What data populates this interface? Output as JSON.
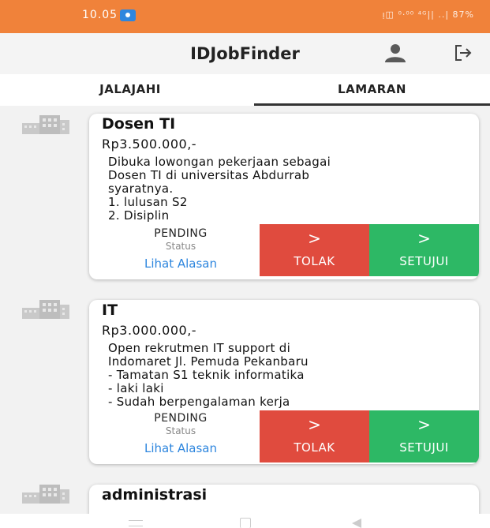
{
  "status_bar": {
    "time": "10.05",
    "right_indicators": "ᴉ◫ ⁰·⁰⁰ ⁴ᴳ|| ..| 87%",
    "battery_percent": 87
  },
  "app_bar": {
    "title": "IDJobFinder",
    "profile_icon": "person-icon",
    "logout_icon": "logout-icon"
  },
  "tabs": [
    {
      "label": "JALAJAHI",
      "active": false
    },
    {
      "label": "LAMARAN",
      "active": true
    }
  ],
  "jobs": [
    {
      "title": "Dosen TI",
      "salary": "Rp3.500.000,-",
      "description": "Dibuka lowongan pekerjaan sebagai\nDosen TI di universitas Abdurrab\nsyaratnya.\n1. lulusan S2\n2. Disiplin",
      "status_value": "PENDING",
      "status_label": "Status",
      "reason_link": "Lihat Alasan",
      "reject_arrow": ">",
      "reject_label": "TOLAK",
      "accept_arrow": ">",
      "accept_label": "SETUJUI"
    },
    {
      "title": "IT",
      "salary": "Rp3.000.000,-",
      "description": "Open rekrutmen IT support di\nIndomaret Jl. Pemuda Pekanbaru\n- Tamatan S1 teknik informatika\n- laki laki\n- Sudah berpengalaman kerja",
      "status_value": "PENDING",
      "status_label": "Status",
      "reason_link": "Lihat Alasan",
      "reject_arrow": ">",
      "reject_label": "TOLAK",
      "accept_arrow": ">",
      "accept_label": "SETUJUI"
    },
    {
      "title": "administrasi"
    }
  ],
  "colors": {
    "status_bar": "#f0823a",
    "reject": "#e04b3e",
    "accept": "#2db865",
    "link": "#2e86de"
  }
}
